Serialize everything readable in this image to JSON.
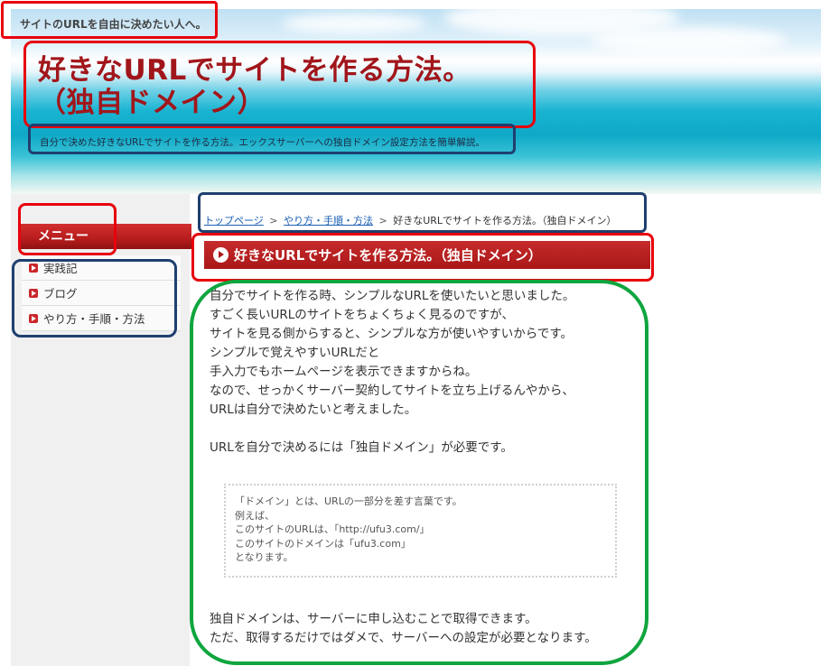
{
  "header": {
    "tagline": "サイトのURLを自由に決めたい人へ。",
    "site_title_line1": "好きなURLでサイトを作る方法。",
    "site_title_line2": "（独自ドメイン）",
    "description": "自分で決めた好きなURLでサイトを作る方法。エックスサーバーへの独自ドメイン設定方法を簡単解説。"
  },
  "sidebar": {
    "heading": "メニュー",
    "items": [
      {
        "label": "実践記"
      },
      {
        "label": "ブログ"
      },
      {
        "label": "やり方・手順・方法"
      }
    ]
  },
  "breadcrumb": {
    "home": "トップページ",
    "separator": ">",
    "category": "やり方・手順・方法",
    "current": "好きなURLでサイトを作る方法。（独自ドメイン）"
  },
  "post": {
    "title": "好きなURLでサイトを作る方法。（独自ドメイン）",
    "paragraph1": [
      "自分でサイトを作る時、シンプルなURLを使いたいと思いました。",
      "すごく長いURLのサイトをちょくちょく見るのですが、",
      "サイトを見る側からすると、シンプルな方が使いやすいからです。",
      "シンプルで覚えやすいURLだと",
      "手入力でもホームページを表示できますからね。",
      "なので、せっかくサーバー契約してサイトを立ち上げるんやから、",
      "URLは自分で決めたいと考えました。"
    ],
    "paragraph2": "URLを自分で決めるには「独自ドメイン」が必要です。",
    "note": [
      "「ドメイン」とは、URLの一部分を差す言葉です。",
      "例えば、",
      "このサイトのURLは、「http://ufu3.com/」",
      "このサイトのドメインは「ufu3.com」",
      "となります。"
    ],
    "paragraph3": [
      "独自ドメインは、サーバーに申し込むことで取得できます。",
      "ただ、取得するだけではダメで、サーバーへの設定が必要となります。"
    ]
  },
  "colors": {
    "title_red": "#a1161b",
    "menu_red": "#b71c1c",
    "link_blue": "#1a5fb4",
    "annotation_red": "#e8000c",
    "annotation_blue": "#1f3f6f",
    "annotation_green": "#0fa53e"
  }
}
